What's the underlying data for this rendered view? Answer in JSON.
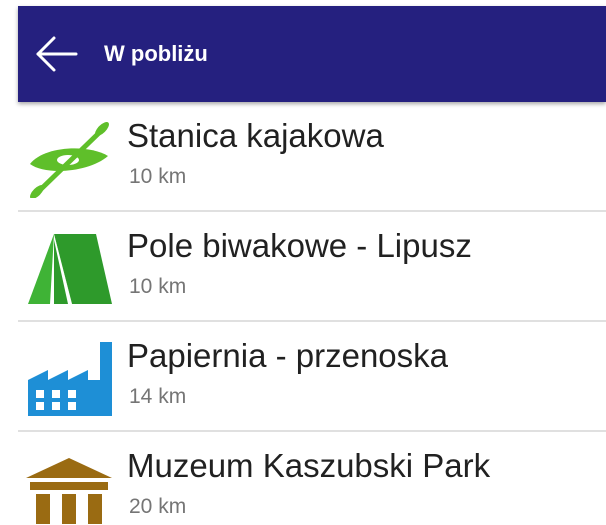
{
  "toolbar": {
    "title": "W pobliżu",
    "back_icon": "arrow-left-icon",
    "color": "#25207f"
  },
  "list": {
    "items": [
      {
        "title": "Stanica kajakowa",
        "distance": "10 km",
        "icon": "kayak-icon",
        "icon_color": "#5fbf2a"
      },
      {
        "title": "Pole biwakowe - Lipusz",
        "distance": "10 km",
        "icon": "tent-icon",
        "icon_color": "#2e9a2b"
      },
      {
        "title": "Papiernia - przenoska",
        "distance": "14 km",
        "icon": "factory-icon",
        "icon_color": "#1e8fd6"
      },
      {
        "title": "Muzeum Kaszubski Park",
        "distance": "20 km",
        "icon": "museum-icon",
        "icon_color": "#9a6b12"
      }
    ]
  }
}
